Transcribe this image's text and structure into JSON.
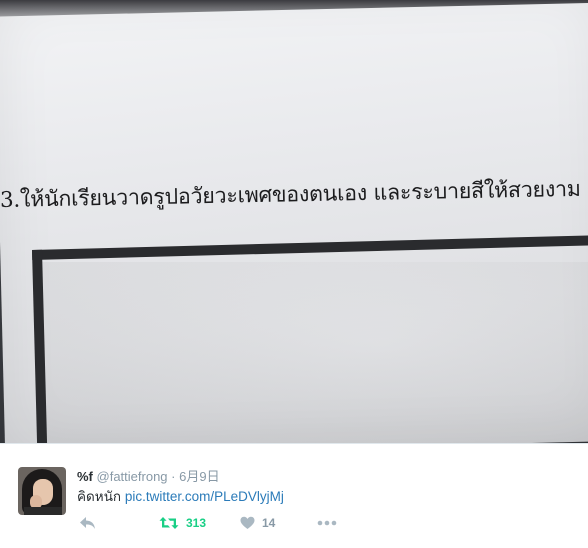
{
  "photo": {
    "question_text": "3.ให้นักเรียนวาดรูปอวัยวะเพศของตนเอง และระบายสีให้สวยงาม"
  },
  "tweet": {
    "display_name": "%f",
    "handle": "@fattiefrong",
    "separator": "·",
    "date": "6月9日",
    "text": "คิดหนัก",
    "link": "pic.twitter.com/PLeDVlyjMj",
    "actions": {
      "reply_icon": "reply-icon",
      "retweet_icon": "retweet-icon",
      "retweet_count": "313",
      "like_icon": "heart-icon",
      "like_count": "14",
      "more_icon": "more-icon"
    },
    "colors": {
      "retweet_active": "#19cf86",
      "link": "#2b7bb9",
      "muted": "#8899a6"
    }
  }
}
